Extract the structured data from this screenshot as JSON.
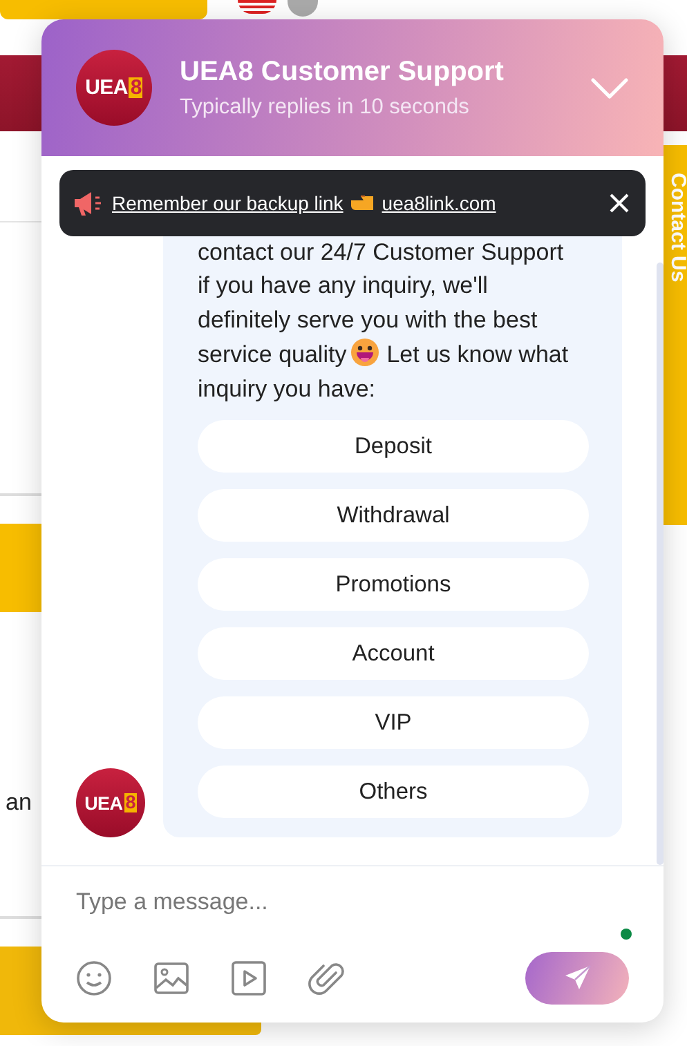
{
  "background": {
    "side_tab": "Contact Us",
    "fragment": "an"
  },
  "chat": {
    "header_logo": {
      "text": "UEA",
      "accent": "8"
    },
    "agent_logo": {
      "text": "UEA",
      "accent": "8"
    },
    "title": "UEA8 Customer Support",
    "subtitle": "Typically replies in 10 seconds",
    "banner": {
      "text": "Remember our backup link",
      "link": "uea8link.com"
    },
    "message": {
      "before": "contact our 24/7 Customer Support if you have any inquiry, we'll definitely serve you with the best service quality",
      "after": "Let us know what inquiry you have:"
    },
    "options": [
      "Deposit",
      "Withdrawal",
      "Promotions",
      "Account",
      "VIP",
      "Others"
    ],
    "composer": {
      "placeholder": "Type a message...",
      "online": true
    }
  }
}
